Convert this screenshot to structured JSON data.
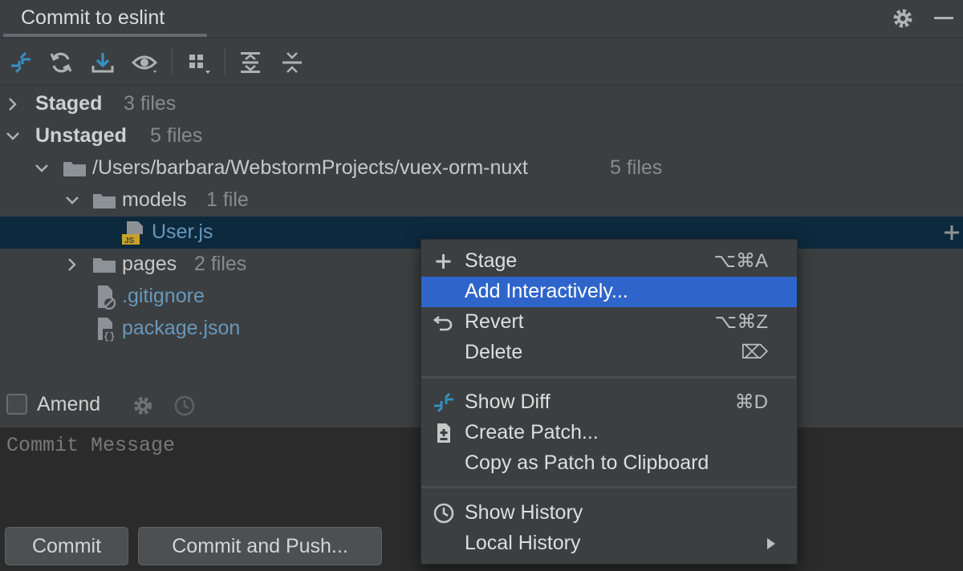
{
  "header": {
    "tab_label": "Commit to eslint"
  },
  "toolbar": {
    "buttons": [
      "show-diff-icon",
      "refresh-icon",
      "update-icon",
      "eye-icon",
      "group-by-icon",
      "expand-all-icon",
      "collapse-all-icon"
    ]
  },
  "tree": {
    "staged": {
      "label": "Staged",
      "count": "3 files"
    },
    "unstaged": {
      "label": "Unstaged",
      "count": "5 files"
    },
    "root": {
      "label": "/Users/barbara/WebstormProjects/vuex-orm-nuxt",
      "count": "5 files"
    },
    "models": {
      "label": "models",
      "count": "1 file"
    },
    "userjs": {
      "label": "User.js",
      "badge": "JS"
    },
    "pages": {
      "label": "pages",
      "count": "2 files"
    },
    "gitignore": {
      "label": ".gitignore"
    },
    "packagejson": {
      "label": "package.json"
    }
  },
  "amend": {
    "label": "Amend"
  },
  "commit_message": {
    "placeholder": "Commit Message"
  },
  "buttons": {
    "commit": "Commit",
    "commit_push": "Commit and Push..."
  },
  "context_menu": {
    "items": [
      {
        "label": "Stage",
        "shortcut": "⌥⌘A",
        "icon": "plus-icon"
      },
      {
        "label": "Add Interactively...",
        "shortcut": "",
        "icon": ""
      },
      {
        "label": "Revert",
        "shortcut": "⌥⌘Z",
        "icon": "undo-icon"
      },
      {
        "label": "Delete",
        "shortcut": "⌦",
        "icon": ""
      },
      {
        "label": "Show Diff",
        "shortcut": "⌘D",
        "icon": "diff-icon"
      },
      {
        "label": "Create Patch...",
        "shortcut": "",
        "icon": "patch-icon"
      },
      {
        "label": "Copy as Patch to Clipboard",
        "shortcut": "",
        "icon": ""
      },
      {
        "label": "Show History",
        "shortcut": "",
        "icon": "clock-icon"
      },
      {
        "label": "Local History",
        "shortcut": "",
        "icon": ""
      }
    ]
  },
  "colors": {
    "background": "#3c3f41",
    "selection": "#0d293e",
    "menu_highlight": "#2f65ca",
    "accent_blue": "#3592c4",
    "file_blue": "#6897bb",
    "js_badge": "#c9a227"
  }
}
